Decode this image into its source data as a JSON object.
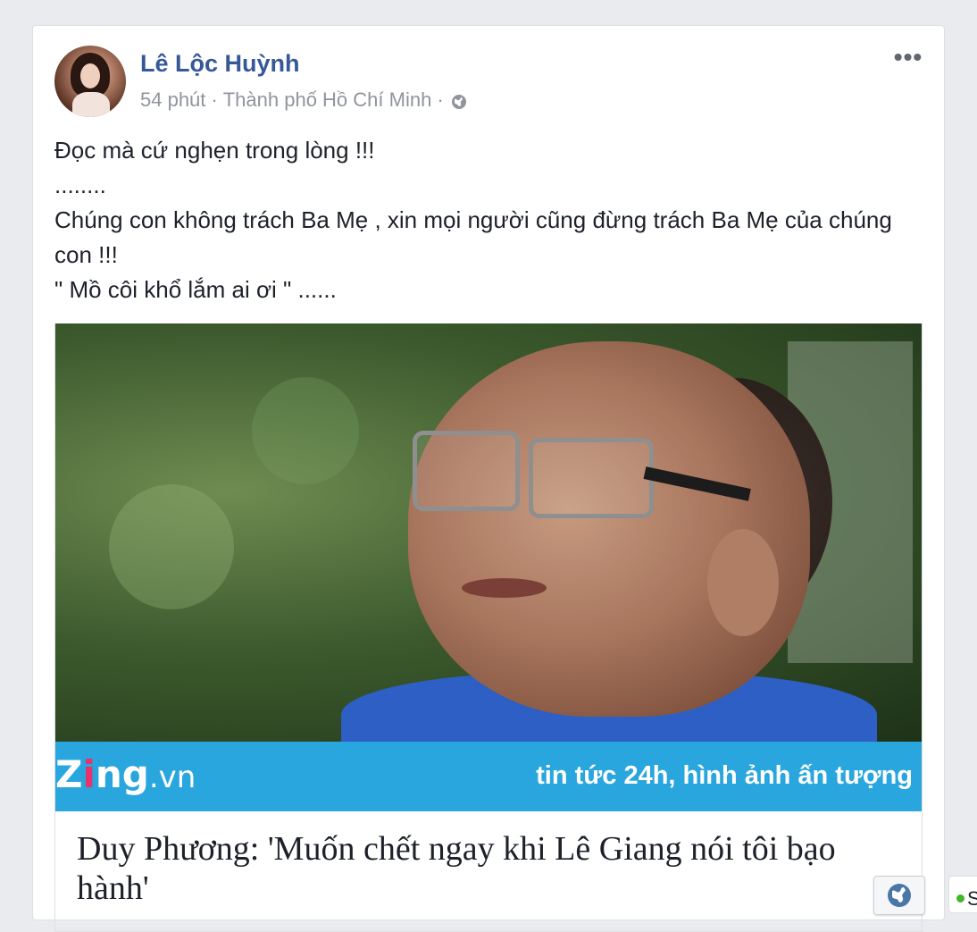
{
  "post": {
    "author": "Lê Lộc Huỳnh",
    "time": "54 phút",
    "separator": "·",
    "location": "Thành phố Hồ Chí Minh",
    "separator2": "·",
    "privacy_icon": "globe-icon",
    "more_label": "•••",
    "text_lines": [
      "Đọc mà cứ nghẹn trong lòng !!!",
      "........",
      "Chúng con không trách Ba Mẹ , xin mọi người cũng đừng trách Ba Mẹ của chúng con !!!",
      "\" Mồ côi khổ lắm ai ơi \" ......"
    ]
  },
  "link": {
    "banner_logo_zing": "Z",
    "banner_logo_i": "i",
    "banner_logo_ng": "ng",
    "banner_logo_vn": ".vn",
    "banner_tagline": "tin tức 24h, hình ảnh ấn tượng",
    "title": "Duy Phương: 'Muốn chết ngay khi Lê Giang nói tôi bạo hành'"
  },
  "side_chip": {
    "text": "S"
  },
  "colors": {
    "author_link": "#365899",
    "banner_blue": "#29a6dd",
    "zing_pink": "#e8326c",
    "online_green": "#42b72a"
  }
}
